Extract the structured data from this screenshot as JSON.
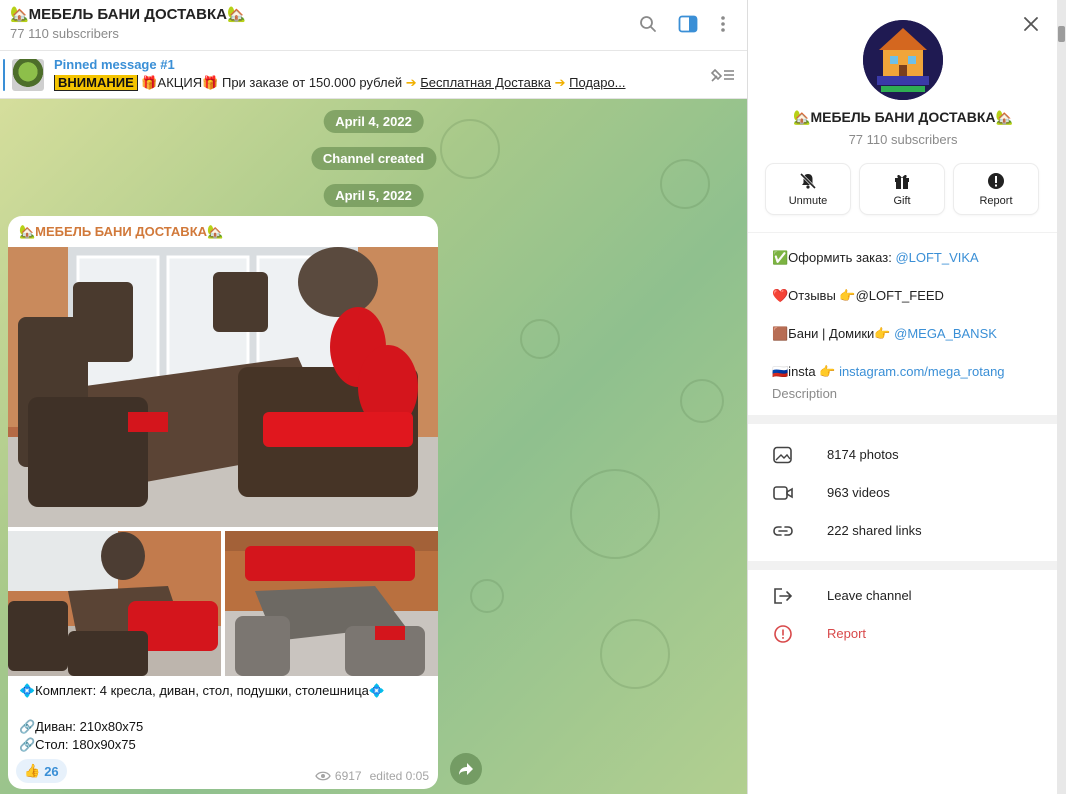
{
  "chat": {
    "title": "🏡МЕБЕЛЬ БАНИ ДОСТАВКА🏡",
    "subscribers": "77 110 subscribers"
  },
  "pinned": {
    "label": "Pinned message #1",
    "badge": "ВНИМАНИЕ",
    "text_1": "🎁АКЦИЯ🎁",
    "text_2": "При заказе от 150.000 рублей",
    "text_3": "Бесплатная Доставка",
    "text_4": "Подаро..."
  },
  "feed": {
    "date_1": "April 4, 2022",
    "service": "Channel created",
    "date_2": "April 5, 2022"
  },
  "message": {
    "author": "🏡МЕБЕЛЬ БАНИ ДОСТАВКА🏡",
    "line_1": "💠Комплект: 4 кресла, диван, стол, подушки, столешница💠",
    "line_2": "🔗Диван: 210x80x75",
    "line_3": "🔗Стол: 180x90x75",
    "reaction_emoji": "👍",
    "reaction_count": "26",
    "views": "6917",
    "edited": "edited 0:05"
  },
  "panel": {
    "name": "🏡МЕБЕЛЬ БАНИ ДОСТАВКА🏡",
    "subscribers": "77 110 subscribers",
    "buttons": {
      "unmute": "Unmute",
      "gift": "Gift",
      "report": "Report"
    },
    "info": {
      "order_prefix": "✅Оформить заказ: ",
      "order_link": "@LOFT_VIKA",
      "reviews": "❤️Отзывы 👉@LOFT_FEED",
      "bani_prefix": "🟫Бани | Домики👉 ",
      "bani_link": "@MEGA_BANSK",
      "insta_prefix": "🇷🇺insta 👉 ",
      "insta_link": "instagram.com/mega_rotang",
      "desc_label": "Description"
    },
    "media": {
      "photos": "8174 photos",
      "videos": "963 videos",
      "links": "222 shared links"
    },
    "actions": {
      "leave": "Leave channel",
      "report": "Report"
    }
  },
  "colors": {
    "accent": "#3a8fd6",
    "author": "#d1793a",
    "danger": "#d8494a",
    "chat_bg": "#a8c98a"
  },
  "icons": [
    "search-icon",
    "sidebar-toggle-icon",
    "more-icon",
    "unpin-icon",
    "close-icon",
    "bell-off-icon",
    "gift-icon",
    "alert-icon",
    "photo-icon",
    "video-icon",
    "link-icon",
    "leave-icon",
    "report-icon",
    "eye-icon",
    "share-icon"
  ]
}
